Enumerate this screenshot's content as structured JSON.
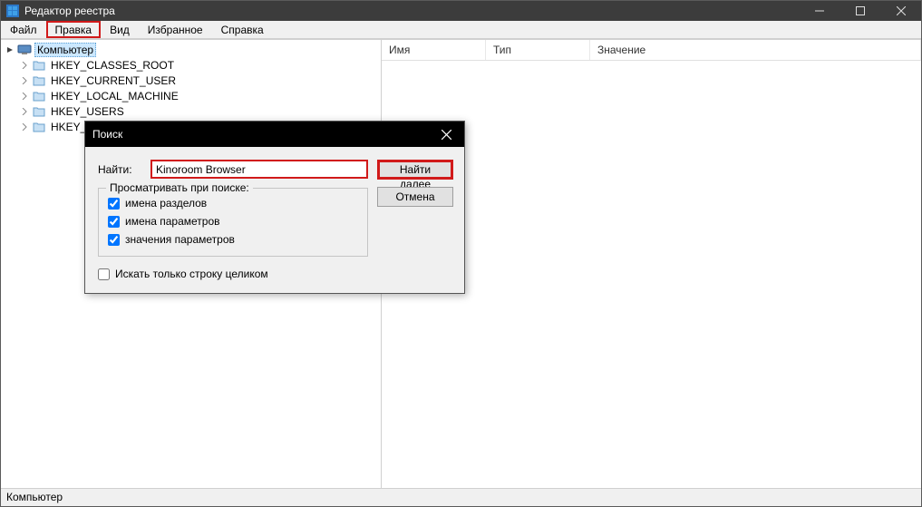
{
  "window": {
    "title": "Редактор реестра"
  },
  "menu": {
    "file": "Файл",
    "edit": "Правка",
    "view": "Вид",
    "favorites": "Избранное",
    "help": "Справка"
  },
  "tree": {
    "root": "Компьютер",
    "items": [
      "HKEY_CLASSES_ROOT",
      "HKEY_CURRENT_USER",
      "HKEY_LOCAL_MACHINE",
      "HKEY_USERS",
      "HKEY_"
    ]
  },
  "columns": {
    "name": "Имя",
    "type": "Тип",
    "value": "Значение"
  },
  "statusbar": "Компьютер",
  "dialog": {
    "title": "Поиск",
    "find_label": "Найти:",
    "find_value": "Kinoroom Browser",
    "group_title": "Просматривать при поиске:",
    "chk_keys": "имена разделов",
    "chk_values": "имена параметров",
    "chk_data": "значения параметров",
    "chk_whole": "Искать только строку целиком",
    "btn_find_next": "Найти далее",
    "btn_cancel": "Отмена"
  }
}
